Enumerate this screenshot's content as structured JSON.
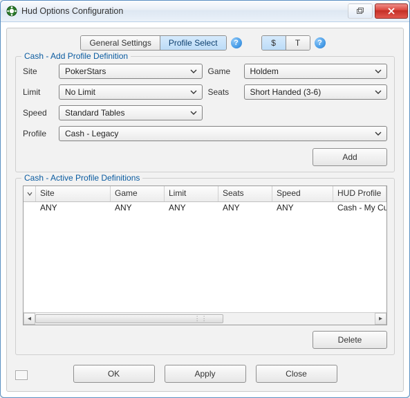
{
  "window": {
    "title": "Hud Options Configuration"
  },
  "top": {
    "general_settings": "General Settings",
    "profile_select": "Profile Select",
    "toggle_dollar": "$",
    "toggle_t": "T"
  },
  "colors": {
    "link": "#0a5ba0"
  },
  "group_add": {
    "legend": "Cash - Add Profile Definition",
    "labels": {
      "site": "Site",
      "game": "Game",
      "limit": "Limit",
      "seats": "Seats",
      "speed": "Speed",
      "profile": "Profile"
    },
    "values": {
      "site": "PokerStars",
      "game": "Holdem",
      "limit": "No Limit",
      "seats": "Short Handed (3-6)",
      "speed": "Standard Tables",
      "profile": "Cash - Legacy"
    },
    "add_button": "Add"
  },
  "group_active": {
    "legend": "Cash - Active Profile Definitions",
    "columns": [
      "Site",
      "Game",
      "Limit",
      "Seats",
      "Speed",
      "HUD Profile"
    ],
    "rows": [
      {
        "site": "ANY",
        "game": "ANY",
        "limit": "ANY",
        "seats": "ANY",
        "speed": "ANY",
        "hud_profile": "Cash - My Custom H"
      }
    ],
    "delete_button": "Delete"
  },
  "footer": {
    "ok": "OK",
    "apply": "Apply",
    "close": "Close"
  }
}
